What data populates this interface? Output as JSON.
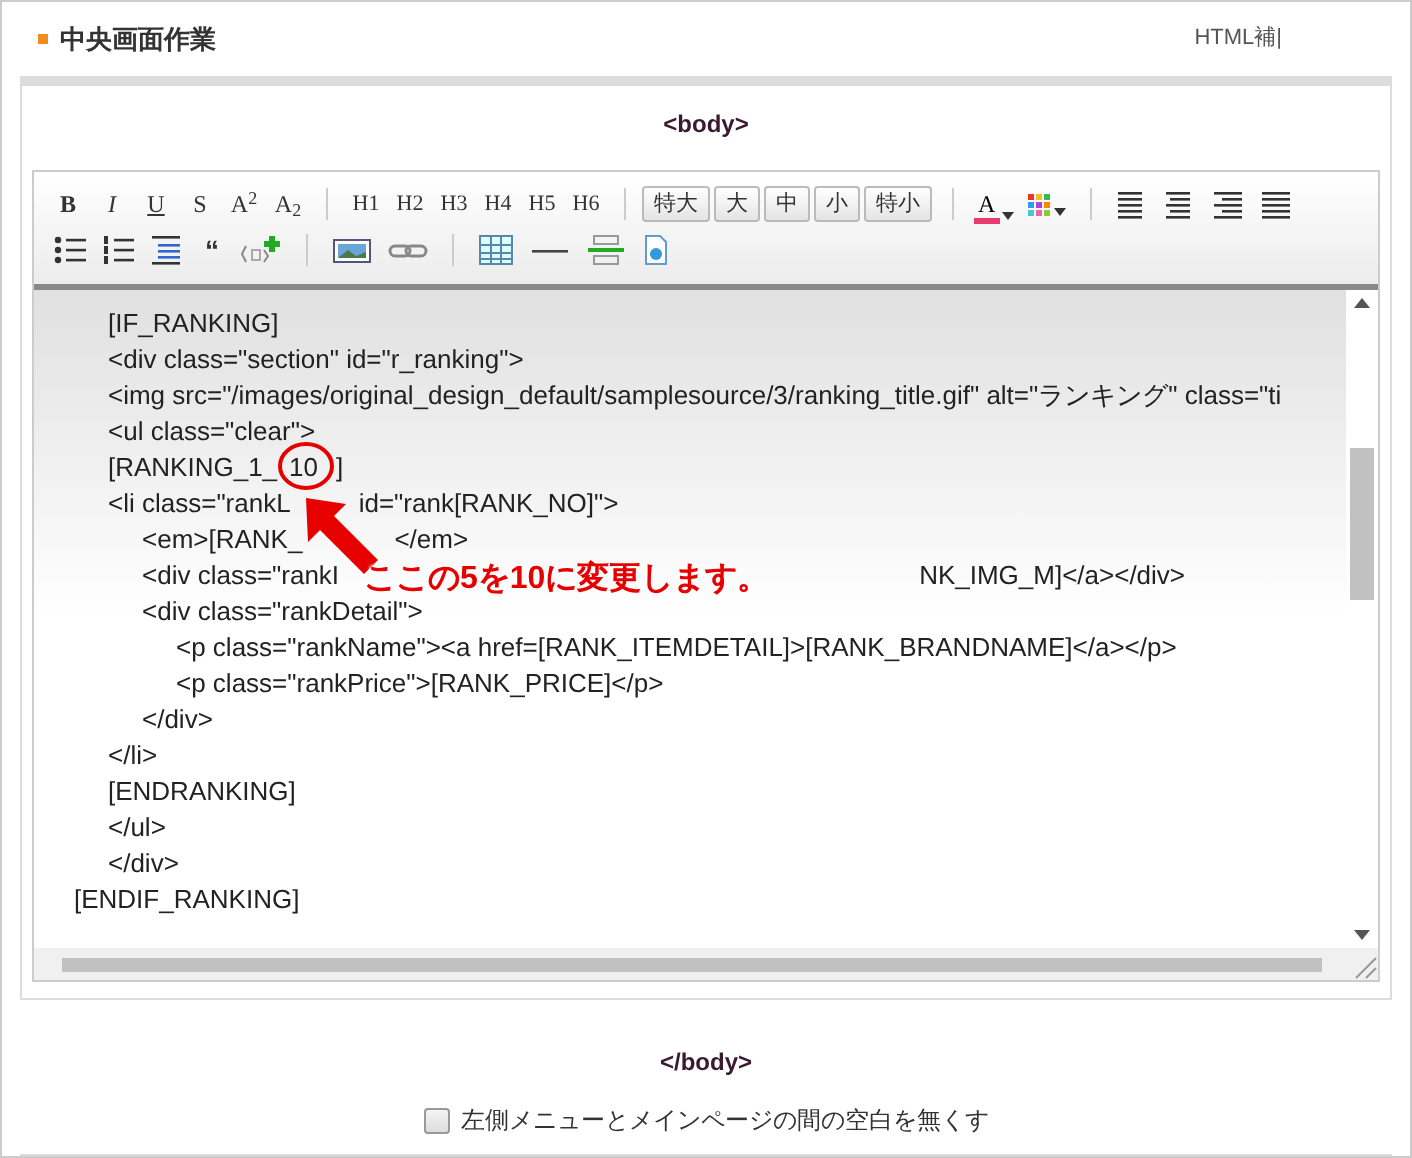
{
  "header": {
    "title": "中央画面作業",
    "link": "HTML補|"
  },
  "body_open": "<body>",
  "toolbar": {
    "format": [
      "B",
      "I",
      "U",
      "S",
      "A$^{2}$",
      "A$_{2}$"
    ],
    "headings": [
      "H1",
      "H2",
      "H3",
      "H4",
      "H5",
      "H6"
    ],
    "sizes": [
      "特大",
      "大",
      "中",
      "小",
      "特小"
    ],
    "font_color": "A",
    "quote": "“"
  },
  "code_lines": [
    {
      "parts": [
        "\t[IF_RANKING]"
      ]
    },
    {
      "parts": [
        "\t<div class=\"section\" id=\"r_ranking\">"
      ]
    },
    {
      "parts": [
        "\t<img src=\"/images/original_design_default/samplesource/3/ranking_title.gif\" alt=\"ランキング\" class=\"ti"
      ]
    },
    {
      "parts": [
        "\t<ul class=\"clear\">"
      ]
    },
    {
      "parts": [
        "\t[RANKING_1_",
        "10",
        "]"
      ]
    },
    {
      "parts": [
        "\t<li class=\"rankL",
        "id=\"rank[RANK_NO]\">"
      ]
    },
    {
      "parts": [
        "\t\t<em>[RANK_",
        "</em>"
      ]
    },
    {
      "parts": [
        "\t\t<div class=\"rankI",
        "NK_IMG_M]</a></div>"
      ]
    },
    {
      "parts": [
        "\t\t<div class=\"rankDetail\">"
      ]
    },
    {
      "parts": [
        "\t\t\t<p class=\"rankName\"><a href=[RANK_ITEMDETAIL]>[RANK_BRANDNAME]</a></p>"
      ]
    },
    {
      "parts": [
        "\t\t\t<p class=\"rankPrice\">[RANK_PRICE]</p>"
      ]
    },
    {
      "parts": [
        "\t\t</div>"
      ]
    },
    {
      "parts": [
        "\t</li>"
      ]
    },
    {
      "parts": [
        "\t[ENDRANKING]"
      ]
    },
    {
      "parts": [
        "\t</ul>"
      ]
    },
    {
      "parts": [
        "\t</div>"
      ]
    },
    {
      "parts": [
        "[ENDIF_RANKING]"
      ]
    }
  ],
  "annotation": "ここの5を10に変更します。",
  "body_close": "</body>",
  "option": {
    "label": "左側メニューとメインページの間の空白を無くす",
    "checked": false
  }
}
